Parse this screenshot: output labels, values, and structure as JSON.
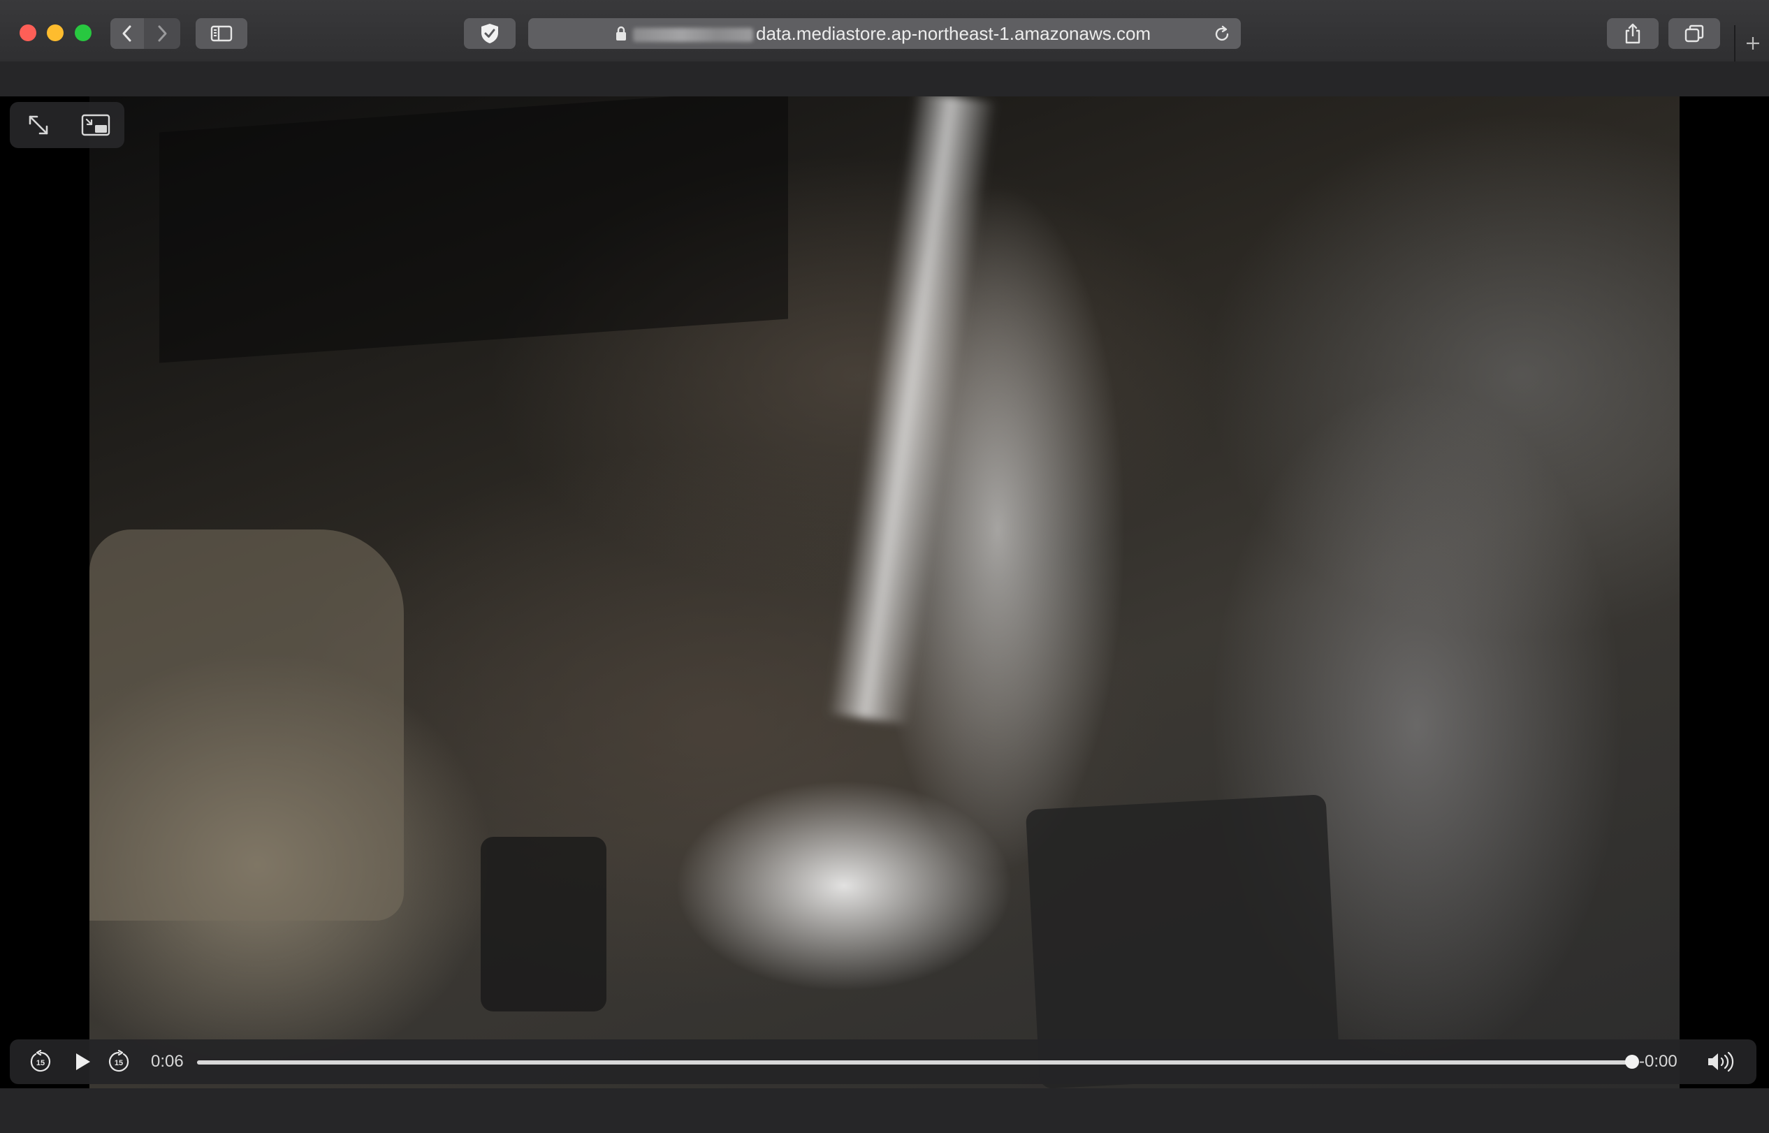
{
  "browser": {
    "url_hidden_prefix": "",
    "url_visible": "data.mediastore.ap-northeast-1.amazonaws.com",
    "colors": {
      "close": "#fe5f57",
      "minimize": "#febc2e",
      "maximize": "#28c840"
    }
  },
  "player": {
    "elapsed": "0:06",
    "remaining": "-0:00",
    "progress": 1.0,
    "skip_back_seconds": "15",
    "skip_forward_seconds": "15"
  }
}
